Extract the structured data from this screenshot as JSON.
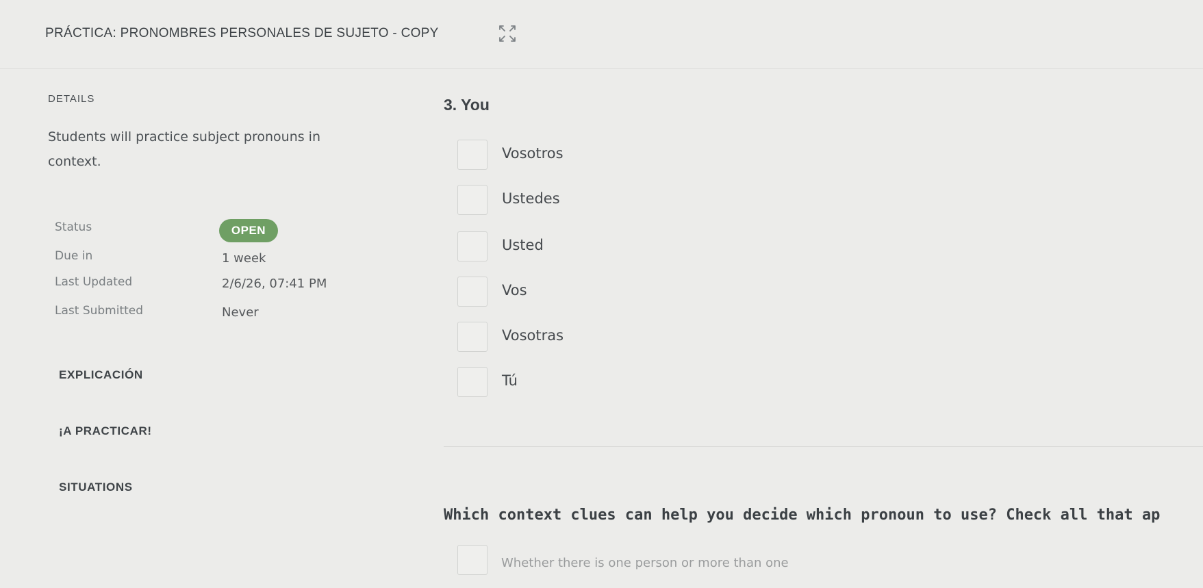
{
  "header": {
    "title": "PRÁCTICA: PRONOMBRES PERSONALES DE SUJETO - COPY",
    "expand_icon": "expand-arrows-icon"
  },
  "details": {
    "heading": "DETAILS",
    "description": "Students will practice subject pronouns in context.",
    "status_label": "Status",
    "status_value": "OPEN",
    "due_label": "Due in",
    "due_value": "1 week",
    "updated_label": "Last Updated",
    "updated_value": "2/6/26, 07:41 PM",
    "submitted_label": "Last Submitted",
    "submitted_value": "Never"
  },
  "sections": {
    "explicacion": "EXPLICACIÓN",
    "practicar": "¡A PRACTICAR!",
    "situations": "SITUATIONS"
  },
  "question": {
    "title": "3. You",
    "options": [
      "Vosotros",
      "Ustedes",
      "Usted",
      "Vos",
      "Vosotras",
      "Tú"
    ]
  },
  "question2": {
    "title": "Which context clues can help you decide which pronoun to use? Check all that ap",
    "first_option_partial": "Whether there is one person or more than one"
  },
  "colors": {
    "background": "#ececea",
    "badge": "#6f9f64",
    "text": "#454a4e"
  }
}
